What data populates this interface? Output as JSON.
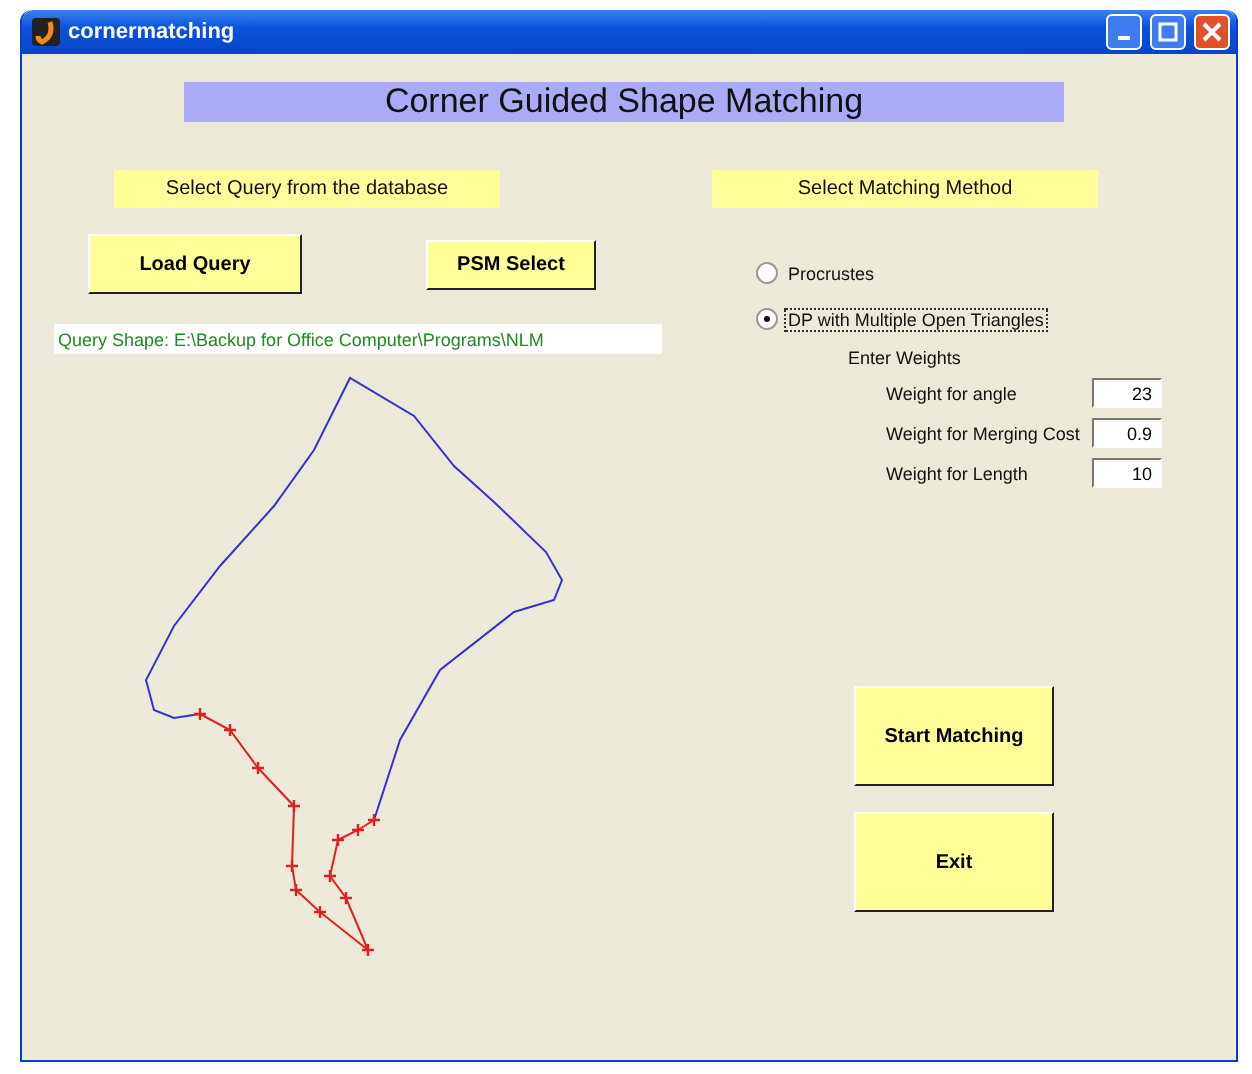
{
  "window": {
    "title": "cornermatching"
  },
  "banner": "Corner Guided Shape Matching",
  "query_panel": {
    "heading": "Select Query from the database",
    "buttons": [
      "Load Query",
      "PSM Select"
    ],
    "query_path": "Query Shape:  E:\\Backup for Office Computer\\Programs\\NLM"
  },
  "method_panel": {
    "heading": "Select Matching Method",
    "methods": [
      {
        "label": "Procrustes",
        "selected": false
      },
      {
        "label": "DP with Multiple Open Triangles",
        "selected": true
      }
    ],
    "weights_heading": "Enter Weights",
    "weights": [
      {
        "label": "Weight for angle",
        "value": "23"
      },
      {
        "label": "Weight for Merging Cost",
        "value": "0.9"
      },
      {
        "label": "Weight for Length",
        "value": "10"
      }
    ]
  },
  "actions": [
    "Start Matching",
    "Exit"
  ]
}
